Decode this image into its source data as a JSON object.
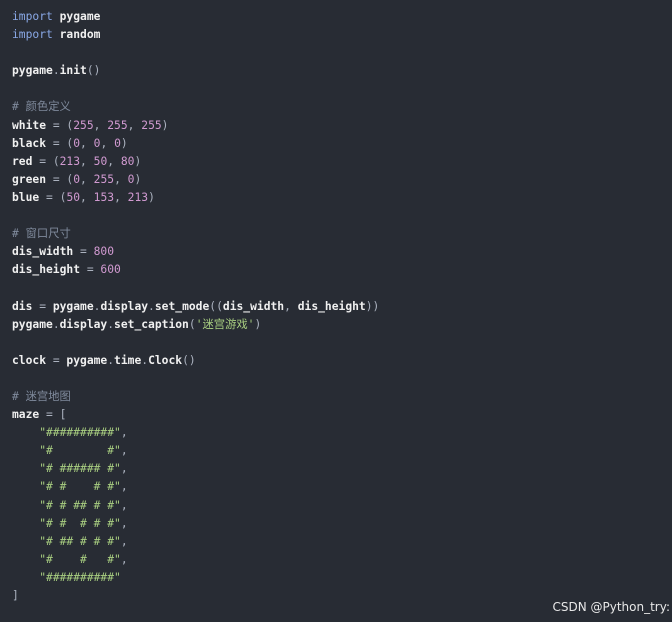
{
  "colors": {
    "background": "#282c34",
    "keyword": "#89a8e6",
    "identifier": "#f0f0f0",
    "number": "#d19ad1",
    "string": "#a9cf81",
    "comment": "#7f8a9c",
    "punctuation": "#abb2bf"
  },
  "code": {
    "language": "python",
    "lines": [
      [
        {
          "t": "kw",
          "v": "import"
        },
        {
          "t": "ws",
          "v": " "
        },
        {
          "t": "id",
          "v": "pygame"
        }
      ],
      [
        {
          "t": "kw",
          "v": "import"
        },
        {
          "t": "ws",
          "v": " "
        },
        {
          "t": "id",
          "v": "random"
        }
      ],
      [],
      [
        {
          "t": "id",
          "v": "pygame"
        },
        {
          "t": "punc",
          "v": "."
        },
        {
          "t": "fn",
          "v": "init"
        },
        {
          "t": "punc",
          "v": "()"
        }
      ],
      [],
      [
        {
          "t": "com",
          "v": "# 颜色定义"
        }
      ],
      [
        {
          "t": "id",
          "v": "white"
        },
        {
          "t": "op",
          "v": " = "
        },
        {
          "t": "punc",
          "v": "("
        },
        {
          "t": "num",
          "v": "255"
        },
        {
          "t": "punc",
          "v": ", "
        },
        {
          "t": "num",
          "v": "255"
        },
        {
          "t": "punc",
          "v": ", "
        },
        {
          "t": "num",
          "v": "255"
        },
        {
          "t": "punc",
          "v": ")"
        }
      ],
      [
        {
          "t": "id",
          "v": "black"
        },
        {
          "t": "op",
          "v": " = "
        },
        {
          "t": "punc",
          "v": "("
        },
        {
          "t": "num",
          "v": "0"
        },
        {
          "t": "punc",
          "v": ", "
        },
        {
          "t": "num",
          "v": "0"
        },
        {
          "t": "punc",
          "v": ", "
        },
        {
          "t": "num",
          "v": "0"
        },
        {
          "t": "punc",
          "v": ")"
        }
      ],
      [
        {
          "t": "id",
          "v": "red"
        },
        {
          "t": "op",
          "v": " = "
        },
        {
          "t": "punc",
          "v": "("
        },
        {
          "t": "num",
          "v": "213"
        },
        {
          "t": "punc",
          "v": ", "
        },
        {
          "t": "num",
          "v": "50"
        },
        {
          "t": "punc",
          "v": ", "
        },
        {
          "t": "num",
          "v": "80"
        },
        {
          "t": "punc",
          "v": ")"
        }
      ],
      [
        {
          "t": "id",
          "v": "green"
        },
        {
          "t": "op",
          "v": " = "
        },
        {
          "t": "punc",
          "v": "("
        },
        {
          "t": "num",
          "v": "0"
        },
        {
          "t": "punc",
          "v": ", "
        },
        {
          "t": "num",
          "v": "255"
        },
        {
          "t": "punc",
          "v": ", "
        },
        {
          "t": "num",
          "v": "0"
        },
        {
          "t": "punc",
          "v": ")"
        }
      ],
      [
        {
          "t": "id",
          "v": "blue"
        },
        {
          "t": "op",
          "v": " = "
        },
        {
          "t": "punc",
          "v": "("
        },
        {
          "t": "num",
          "v": "50"
        },
        {
          "t": "punc",
          "v": ", "
        },
        {
          "t": "num",
          "v": "153"
        },
        {
          "t": "punc",
          "v": ", "
        },
        {
          "t": "num",
          "v": "213"
        },
        {
          "t": "punc",
          "v": ")"
        }
      ],
      [],
      [
        {
          "t": "com",
          "v": "# 窗口尺寸"
        }
      ],
      [
        {
          "t": "id",
          "v": "dis_width"
        },
        {
          "t": "op",
          "v": " = "
        },
        {
          "t": "num",
          "v": "800"
        }
      ],
      [
        {
          "t": "id",
          "v": "dis_height"
        },
        {
          "t": "op",
          "v": " = "
        },
        {
          "t": "num",
          "v": "600"
        }
      ],
      [],
      [
        {
          "t": "id",
          "v": "dis"
        },
        {
          "t": "op",
          "v": " = "
        },
        {
          "t": "id",
          "v": "pygame"
        },
        {
          "t": "punc",
          "v": "."
        },
        {
          "t": "id",
          "v": "display"
        },
        {
          "t": "punc",
          "v": "."
        },
        {
          "t": "fn",
          "v": "set_mode"
        },
        {
          "t": "punc",
          "v": "(("
        },
        {
          "t": "id",
          "v": "dis_width"
        },
        {
          "t": "punc",
          "v": ", "
        },
        {
          "t": "id",
          "v": "dis_height"
        },
        {
          "t": "punc",
          "v": "))"
        }
      ],
      [
        {
          "t": "id",
          "v": "pygame"
        },
        {
          "t": "punc",
          "v": "."
        },
        {
          "t": "id",
          "v": "display"
        },
        {
          "t": "punc",
          "v": "."
        },
        {
          "t": "fn",
          "v": "set_caption"
        },
        {
          "t": "punc",
          "v": "("
        },
        {
          "t": "str",
          "v": "'迷宫游戏'"
        },
        {
          "t": "punc",
          "v": ")"
        }
      ],
      [],
      [
        {
          "t": "id",
          "v": "clock"
        },
        {
          "t": "op",
          "v": " = "
        },
        {
          "t": "id",
          "v": "pygame"
        },
        {
          "t": "punc",
          "v": "."
        },
        {
          "t": "id",
          "v": "time"
        },
        {
          "t": "punc",
          "v": "."
        },
        {
          "t": "fn",
          "v": "Clock"
        },
        {
          "t": "punc",
          "v": "()"
        }
      ],
      [],
      [
        {
          "t": "com",
          "v": "# 迷宫地图"
        }
      ],
      [
        {
          "t": "id",
          "v": "maze"
        },
        {
          "t": "op",
          "v": " = "
        },
        {
          "t": "punc",
          "v": "["
        }
      ],
      [
        {
          "t": "ws",
          "v": "    "
        },
        {
          "t": "str",
          "v": "\"##########\""
        },
        {
          "t": "punc",
          "v": ","
        }
      ],
      [
        {
          "t": "ws",
          "v": "    "
        },
        {
          "t": "str",
          "v": "\"#        #\""
        },
        {
          "t": "punc",
          "v": ","
        }
      ],
      [
        {
          "t": "ws",
          "v": "    "
        },
        {
          "t": "str",
          "v": "\"# ###### #\""
        },
        {
          "t": "punc",
          "v": ","
        }
      ],
      [
        {
          "t": "ws",
          "v": "    "
        },
        {
          "t": "str",
          "v": "\"# #    # #\""
        },
        {
          "t": "punc",
          "v": ","
        }
      ],
      [
        {
          "t": "ws",
          "v": "    "
        },
        {
          "t": "str",
          "v": "\"# # ## # #\""
        },
        {
          "t": "punc",
          "v": ","
        }
      ],
      [
        {
          "t": "ws",
          "v": "    "
        },
        {
          "t": "str",
          "v": "\"# #  # # #\""
        },
        {
          "t": "punc",
          "v": ","
        }
      ],
      [
        {
          "t": "ws",
          "v": "    "
        },
        {
          "t": "str",
          "v": "\"# ## # # #\""
        },
        {
          "t": "punc",
          "v": ","
        }
      ],
      [
        {
          "t": "ws",
          "v": "    "
        },
        {
          "t": "str",
          "v": "\"#    #   #\""
        },
        {
          "t": "punc",
          "v": ","
        }
      ],
      [
        {
          "t": "ws",
          "v": "    "
        },
        {
          "t": "str",
          "v": "\"##########\""
        }
      ],
      [
        {
          "t": "punc",
          "v": "]"
        }
      ]
    ]
  },
  "watermark": {
    "text": "CSDN @Python_try:"
  }
}
